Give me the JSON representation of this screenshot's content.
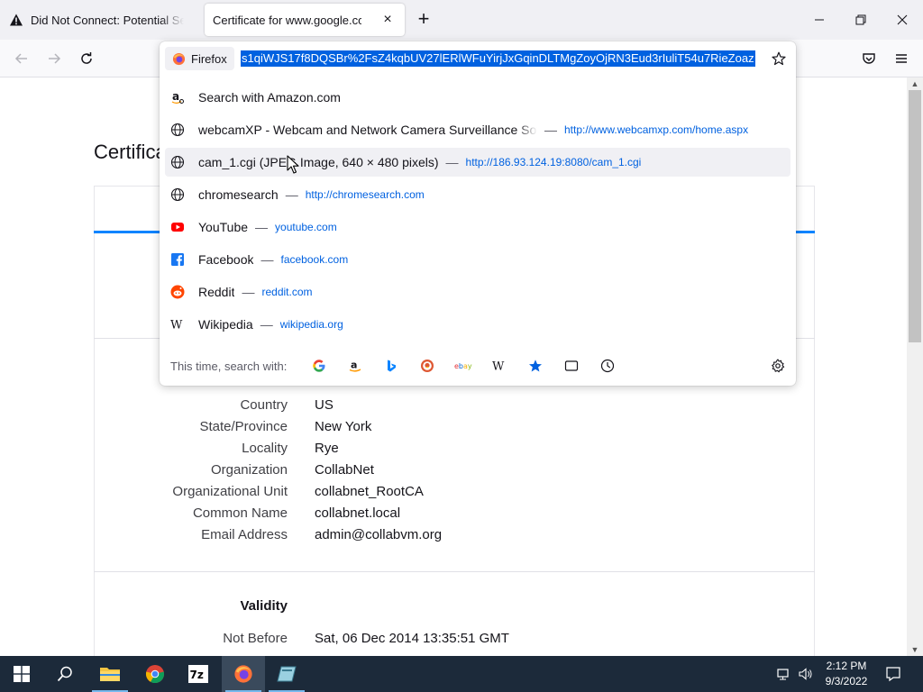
{
  "tabs": [
    {
      "title": "Did Not Connect: Potential Security Issue",
      "icon": "warning-icon",
      "active": false
    },
    {
      "title": "Certificate for www.google.com",
      "icon": "none",
      "active": true
    }
  ],
  "tab_close_glyph": "×",
  "new_tab_glyph": "+",
  "urlbar": {
    "identity_label": "Firefox",
    "url_text": "s1qiWJS17f8DQSBr%2FsZ4kqbUV27lERlWFuYirjJxGqinDLTMgZoyOjRN3Eud3rIuliT54u7RieZoaz"
  },
  "results": [
    {
      "title": "Search with Amazon.com",
      "url": "",
      "icon": "amazon-search-icon"
    },
    {
      "title": "webcamXP - Webcam and Network Camera Surveillance Softw",
      "url": "http://www.webcamxp.com/home.aspx",
      "icon": "globe-icon"
    },
    {
      "title": "cam_1.cgi (JPEG Image, 640 × 480 pixels)",
      "url": "http://186.93.124.19:8080/cam_1.cgi",
      "icon": "globe-icon"
    },
    {
      "title": "chromesearch",
      "url": "http://chromesearch.com",
      "icon": "globe-icon"
    },
    {
      "title": "YouTube",
      "url": "youtube.com",
      "icon": "youtube-icon"
    },
    {
      "title": "Facebook",
      "url": "facebook.com",
      "icon": "facebook-icon"
    },
    {
      "title": "Reddit",
      "url": "reddit.com",
      "icon": "reddit-icon"
    },
    {
      "title": "Wikipedia",
      "url": "wikipedia.org",
      "icon": "wikipedia-icon"
    }
  ],
  "separator": "—",
  "search_with_label": "This time, search with:",
  "search_engines": [
    "google-icon",
    "amazon-icon",
    "bing-icon",
    "duckduckgo-icon",
    "ebay-icon",
    "wikipedia-icon",
    "bookmarks-icon",
    "tabs-icon",
    "history-icon"
  ],
  "page": {
    "title": "Certificate for www.google.com",
    "fields": [
      {
        "label": "Country",
        "value": "US"
      },
      {
        "label": "State/Province",
        "value": "New York"
      },
      {
        "label": "Locality",
        "value": "Rye"
      },
      {
        "label": "Organization",
        "value": "CollabNet"
      },
      {
        "label": "Organizational Unit",
        "value": "collabnet_RootCA"
      },
      {
        "label": "Common Name",
        "value": "collabnet.local"
      },
      {
        "label": "Email Address",
        "value": "admin@collabvm.org"
      }
    ],
    "validity_heading": "Validity",
    "validity_fields": [
      {
        "label": "Not Before",
        "value": "Sat, 06 Dec 2014 13:35:51 GMT"
      }
    ]
  },
  "clock": {
    "time": "2:12 PM",
    "date": "9/3/2022"
  },
  "colors": {
    "accent": "#0a84ff",
    "link": "#0061e0",
    "selection": "#0061e0",
    "taskbar": "#1c2a3a"
  }
}
